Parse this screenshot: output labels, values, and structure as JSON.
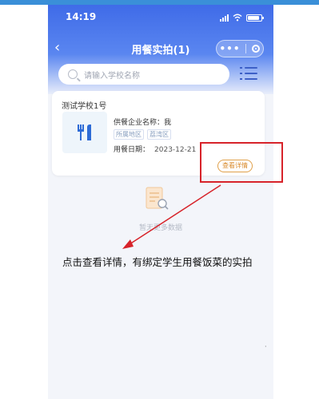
{
  "status_bar": {
    "time": "14:19"
  },
  "nav": {
    "title": "用餐实拍(1)"
  },
  "search": {
    "placeholder": "请输入学校名称"
  },
  "card": {
    "school_name": "测试学校1号",
    "supplier_label": "供餐企业名称：我",
    "tags": [
      "所属地区",
      "荔湾区"
    ],
    "date_label": "用餐日期：",
    "date_value": "2023-12-21",
    "detail_button": "查看详情"
  },
  "empty_state": {
    "text": "暂无更多数据"
  },
  "annotation": {
    "text": "点击查看详情，有绑定学生用餐饭菜的实拍"
  },
  "colors": {
    "accent": "#3f6be8",
    "highlight": "#d7232a",
    "button": "#e0a04a"
  }
}
